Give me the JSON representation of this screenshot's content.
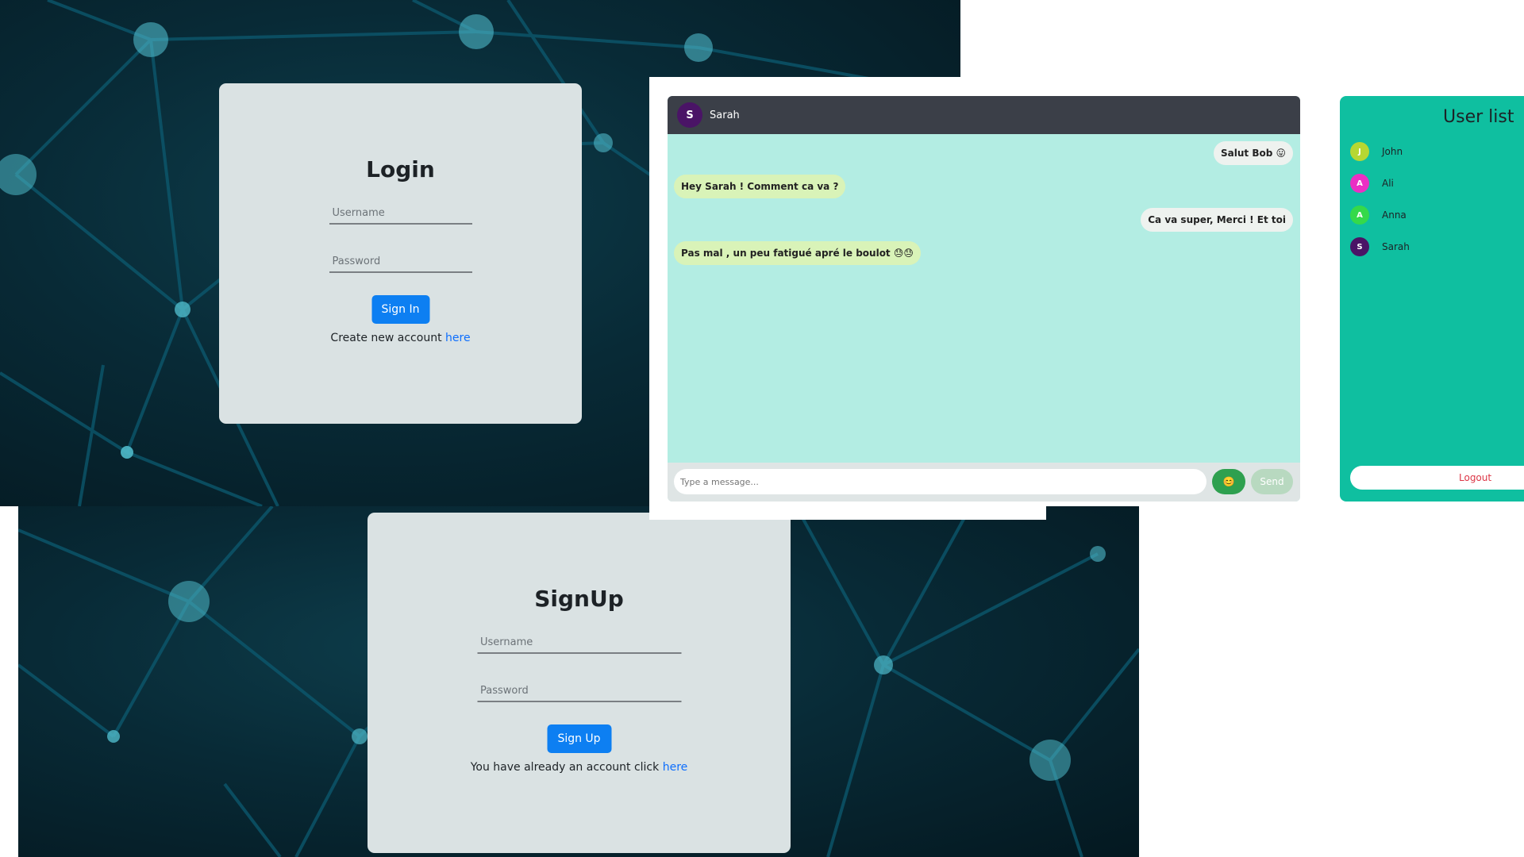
{
  "login": {
    "title": "Login",
    "username_placeholder": "Username",
    "password_placeholder": "Password",
    "button": "Sign In",
    "note": "Create new account",
    "link": "here"
  },
  "signup": {
    "title": "SignUp",
    "username_placeholder": "Username",
    "password_placeholder": "Password",
    "button": "Sign Up",
    "note": "You have already an account click",
    "link": "here"
  },
  "chat": {
    "contact": {
      "initial": "S",
      "name": "Sarah",
      "color": "#4a1466"
    },
    "messages": [
      {
        "dir": "out",
        "text": "Salut Bob 😛"
      },
      {
        "dir": "in",
        "text": "Hey Sarah ! Comment ca va ?"
      },
      {
        "dir": "out",
        "text": "Ca va super, Merci ! Et toi"
      },
      {
        "dir": "in",
        "text": "Pas mal , un peu fatigué apré le boulot 😓😓"
      }
    ],
    "input_placeholder": "Type a message...",
    "emoji_icon": "😊",
    "send": "Send"
  },
  "userlist": {
    "title": "User list",
    "users": [
      {
        "initial": "J",
        "name": "John",
        "color": "#b6d732"
      },
      {
        "initial": "A",
        "name": "Ali",
        "color": "#ea2fc4"
      },
      {
        "initial": "A",
        "name": "Anna",
        "color": "#35d94a"
      },
      {
        "initial": "S",
        "name": "Sarah",
        "color": "#4a1466"
      }
    ],
    "logout": "Logout"
  }
}
